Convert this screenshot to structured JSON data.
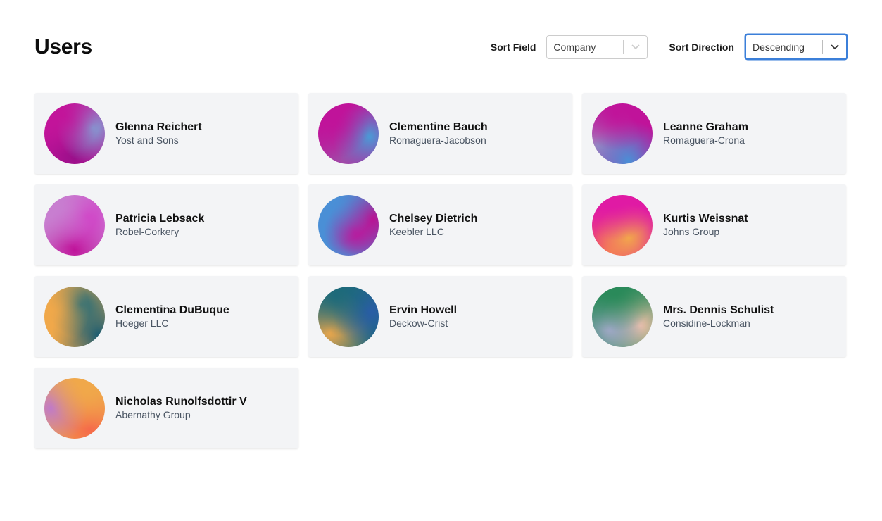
{
  "header": {
    "title": "Users",
    "sort_field": {
      "label": "Sort Field",
      "value": "Company"
    },
    "sort_direction": {
      "label": "Sort Direction",
      "value": "Descending"
    }
  },
  "users": [
    {
      "name": "Glenna Reichert",
      "company": "Yost and Sons",
      "avatar_colors": [
        "#c2149a",
        "#7fa4d6",
        "#9a0f8a"
      ]
    },
    {
      "name": "Clementine Bauch",
      "company": "Romaguera-Jacobson",
      "avatar_colors": [
        "#c0139a",
        "#4a9ad6",
        "#a04aa8"
      ]
    },
    {
      "name": "Leanne Graham",
      "company": "Romaguera-Crona",
      "avatar_colors": [
        "#c0139a",
        "#4a8fd6",
        "#a085c0"
      ]
    },
    {
      "name": "Patricia Lebsack",
      "company": "Robel-Corkery",
      "avatar_colors": [
        "#c87ed0",
        "#d23cc6",
        "#c0139a"
      ]
    },
    {
      "name": "Chelsey Dietrich",
      "company": "Keebler LLC",
      "avatar_colors": [
        "#4a8fd6",
        "#c0139a",
        "#b51490"
      ]
    },
    {
      "name": "Kurtis Weissnat",
      "company": "Johns Group",
      "avatar_colors": [
        "#e01aa4",
        "#f2a84a",
        "#f56a5a"
      ]
    },
    {
      "name": "Clementina DuBuque",
      "company": "Hoeger LLC",
      "avatar_colors": [
        "#f0a84a",
        "#1d6a7a",
        "#1a5c72"
      ]
    },
    {
      "name": "Ervin Howell",
      "company": "Deckow-Crist",
      "avatar_colors": [
        "#1d6a7a",
        "#2a5ca8",
        "#f0a84a"
      ]
    },
    {
      "name": "Mrs. Dennis Schulist",
      "company": "Considine-Lockman",
      "avatar_colors": [
        "#2a8a5a",
        "#a0a8c8",
        "#f0c0a8"
      ]
    },
    {
      "name": "Nicholas Runolfsdottir V",
      "company": "Abernathy Group",
      "avatar_colors": [
        "#f0a84a",
        "#c07ac8",
        "#f56a4a"
      ]
    }
  ]
}
